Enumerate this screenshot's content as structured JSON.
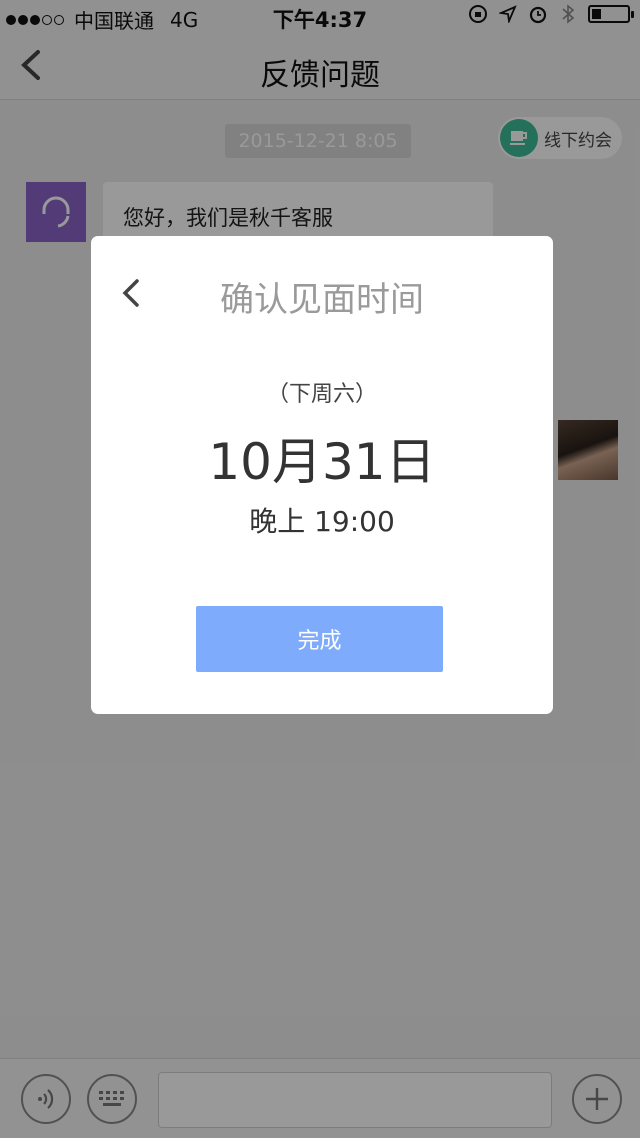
{
  "status_bar": {
    "carrier": "中国联通",
    "network": "4G",
    "time": "下午4:37",
    "signal_strength_of_5": 3,
    "battery_level": 0.25
  },
  "nav": {
    "title": "反馈问题",
    "back_icon": "chevron-left-icon"
  },
  "chat": {
    "timestamp": "2015-12-21   8:05",
    "offline_button_label": "线下约会",
    "offline_icon": "coffee-cup-icon",
    "messages": [
      {
        "sender": "customer-service",
        "text": "您好，我们是秋千客服"
      }
    ]
  },
  "dialog": {
    "title": "确认见面时间",
    "back_icon": "chevron-left-icon",
    "weekday": "（下周六）",
    "date": "10月31日",
    "time": "晚上 19:00",
    "done_label": "完成"
  },
  "input_bar": {
    "voice_icon": "voice-icon",
    "keyboard_icon": "keyboard-icon",
    "add_icon": "plus-icon"
  },
  "colors": {
    "accent_button": "#7fabfd",
    "offline_icon_bg": "#3dbb97",
    "cs_avatar_bg": "#8a63c9",
    "overlay": "rgba(0,0,0,0.4)"
  }
}
